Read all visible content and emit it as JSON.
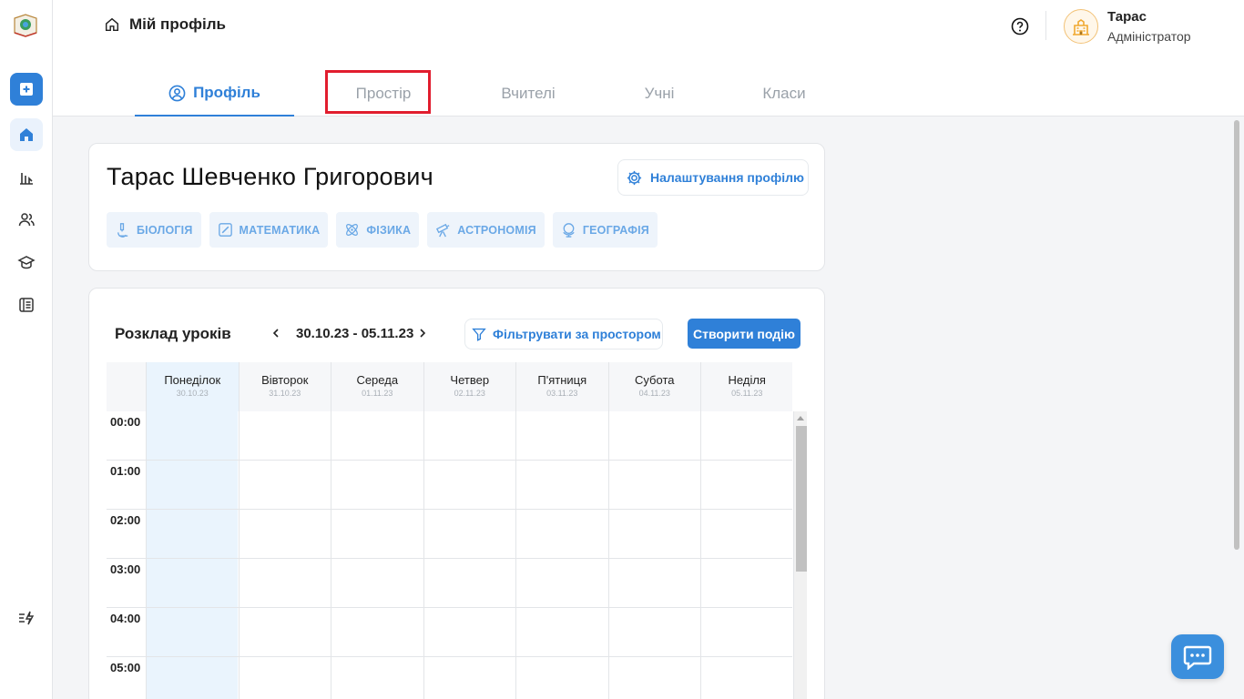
{
  "breadcrumb": {
    "title": "Мій профіль"
  },
  "user": {
    "name": "Тарас",
    "role": "Адміністратор"
  },
  "tabs": [
    {
      "label": "Профіль",
      "active": true
    },
    {
      "label": "Простір",
      "active": false
    },
    {
      "label": "Вчителі",
      "active": false
    },
    {
      "label": "Учні",
      "active": false
    },
    {
      "label": "Класи",
      "active": false
    }
  ],
  "profile": {
    "full_name": "Тарас Шевченко Григорович",
    "settings_label": "Налаштування профілю",
    "subjects": [
      "БІОЛОГІЯ",
      "МАТЕМАТИКА",
      "ФІЗИКА",
      "АСТРОНОМІЯ",
      "ГЕОГРАФІЯ"
    ]
  },
  "schedule": {
    "title": "Розклад уроків",
    "week_range": "30.10.23 - 05.11.23",
    "filter_label": "Фільтрувати за простором",
    "create_label": "Створити подію",
    "days": [
      {
        "name": "Понеділок",
        "date": "30.10.23"
      },
      {
        "name": "Вівторок",
        "date": "31.10.23"
      },
      {
        "name": "Середа",
        "date": "01.11.23"
      },
      {
        "name": "Четвер",
        "date": "02.11.23"
      },
      {
        "name": "П'ятниця",
        "date": "03.11.23"
      },
      {
        "name": "Субота",
        "date": "04.11.23"
      },
      {
        "name": "Неділя",
        "date": "05.11.23"
      }
    ],
    "hours": [
      "00:00",
      "01:00",
      "02:00",
      "03:00",
      "04:00",
      "05:00"
    ]
  },
  "colors": {
    "accent": "#2f80d8",
    "highlight": "#e11d2e",
    "today_bg": "#eaf4fd"
  }
}
